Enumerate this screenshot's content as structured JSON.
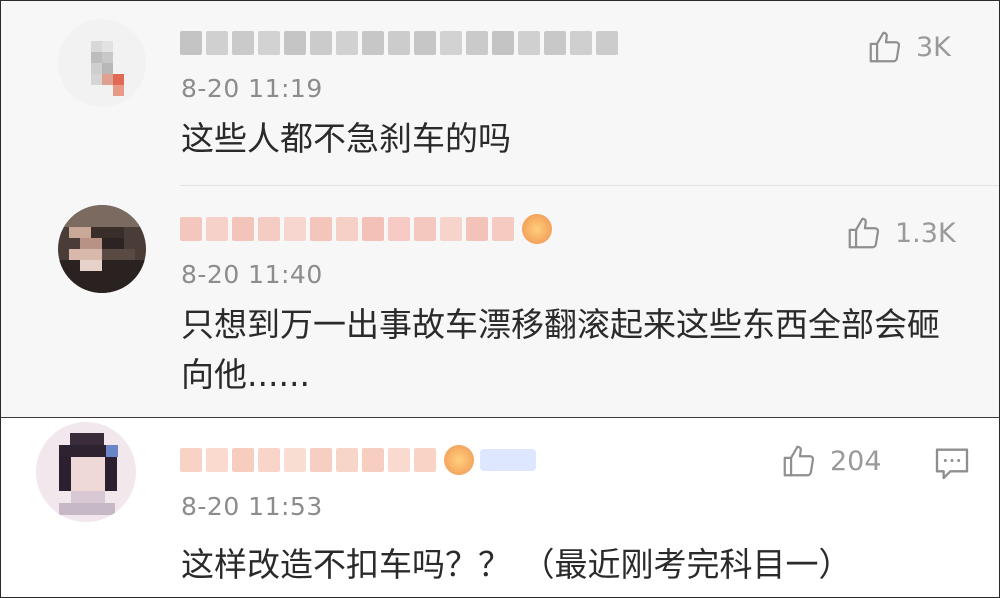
{
  "comments": [
    {
      "time": "8-20 11:19",
      "text": "这些人都不急刹车的吗",
      "likes": "3K",
      "like_icon": "thumbs-up-icon",
      "name_color": "#7a7a7a"
    },
    {
      "time": "8-20 11:40",
      "text": "只想到万一出事故车漂移翻滚起来这些东西全部会砸向他......",
      "likes": "1.3K",
      "like_icon": "thumbs-up-icon",
      "name_color": "#f29a8a"
    },
    {
      "time": "8-20 11:53",
      "text": "这样改造不扣车吗？？ （最近刚考完科目一）",
      "likes": "204",
      "like_icon": "thumbs-up-icon",
      "reply_icon": "comment-icon",
      "name_color": "#f0a48a"
    }
  ]
}
